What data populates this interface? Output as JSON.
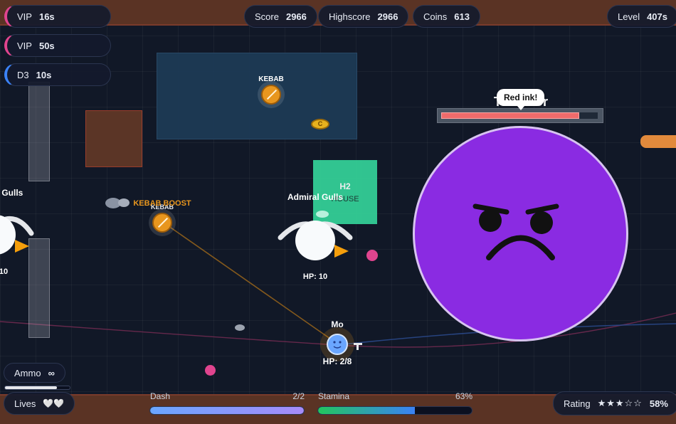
{
  "hud": {
    "buffs": [
      {
        "name": "VIP",
        "time": "16s"
      },
      {
        "name": "VIP",
        "time": "50s"
      },
      {
        "name": "D3",
        "time": "10s"
      }
    ],
    "score_label": "Score",
    "score_value": "2966",
    "highscore_label": "Highscore",
    "highscore_value": "2966",
    "coins_label": "Coins",
    "coins_value": "613",
    "level_label": "Level",
    "level_value": "407s",
    "ammo_label": "Ammo",
    "ammo_value": "∞",
    "lives_label": "Lives",
    "lives_value": "🤍🤍",
    "dash_label": "Dash",
    "dash_value": "2/2",
    "dash_fraction": 1.0,
    "stamina_label": "Stamina",
    "stamina_value": "63%",
    "stamina_fraction": 0.63,
    "rating_label": "Rating",
    "rating_stars": "★★★☆☆",
    "rating_value": "58%"
  },
  "world": {
    "house_code": "H2",
    "house_label": "HOUSE",
    "kebab_label": "KEBAB",
    "kebab_boost_label": "KEBAB BOOST",
    "coin_symbol": "C",
    "gull_name": "Admiral Gulls",
    "gull_hp": "HP: 10",
    "edge_gull_name": "l Gulls",
    "edge_gull_hp": "10",
    "player_name": "Mo",
    "player_hp": "HP: 2/8",
    "boss_name": "The    tor",
    "boss_speech": "Red ink!",
    "boss_hp_fraction": 0.88
  },
  "colors": {
    "boss": "#8a2be2",
    "house": "#34d399",
    "kebab": "#e8961e",
    "player": "#6aa6ff",
    "vip": "#e0448e",
    "d3": "#3b82f6"
  }
}
